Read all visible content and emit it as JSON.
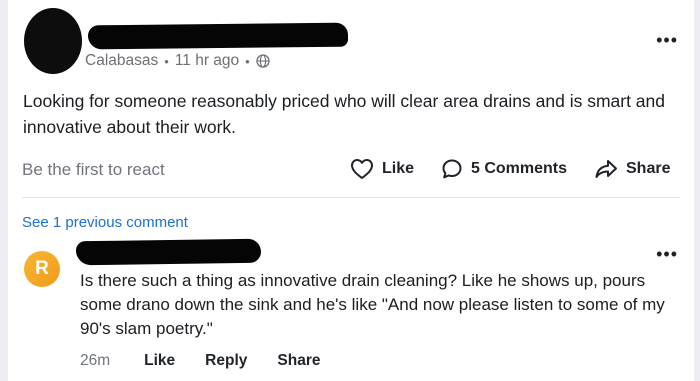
{
  "post": {
    "location": "Calabasas",
    "separator": "•",
    "time_ago": "11 hr ago",
    "separator2": "•",
    "visibility_icon": "globe-icon",
    "more_icon": "•••",
    "text": "Looking for someone reasonably priced who will clear area drains and is smart and innovative about their work."
  },
  "actions": {
    "react_prompt": "Be the first to react",
    "like_label": "Like",
    "comments_label": "5 Comments",
    "share_label": "Share"
  },
  "previous_comments_link": "See 1 previous comment",
  "comment": {
    "avatar_initial": "R",
    "avatar_color": "#f5a623",
    "more_icon": "•••",
    "text": "Is there such a thing as innovative drain cleaning? Like he shows up, pours some drano down the sink and he's like \"And now please listen to some of my 90's slam poetry.\"",
    "time_ago": "26m",
    "like_label": "Like",
    "reply_label": "Reply",
    "share_label": "Share"
  },
  "colors": {
    "link": "#1d6fd1",
    "muted_text": "#70747b"
  }
}
